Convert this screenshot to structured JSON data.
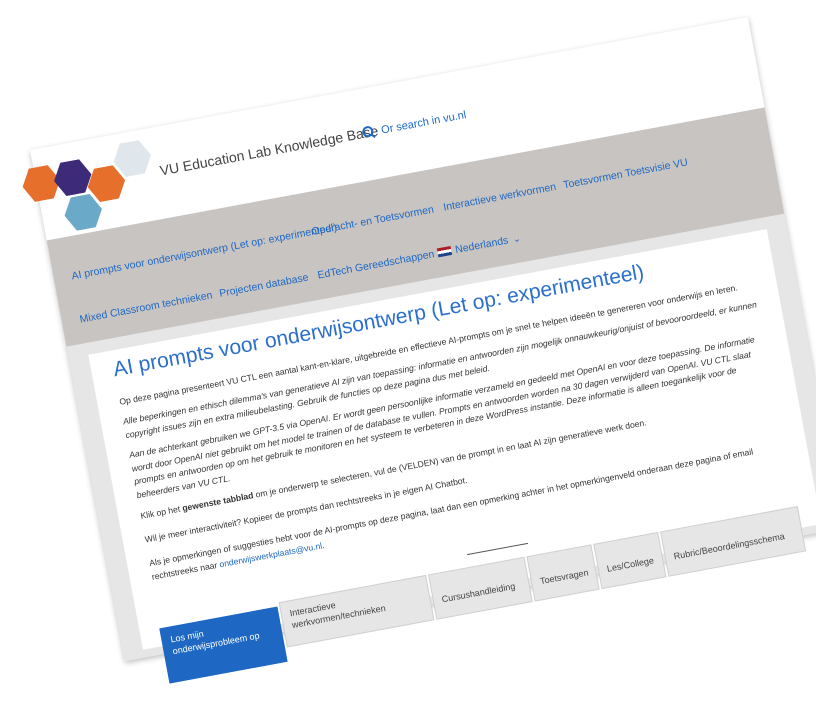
{
  "header": {
    "site_title": "VU Education Lab Knowledge Base",
    "search_link": "Or search in vu.nl"
  },
  "logo": {
    "hex_colors": [
      "#e6702b",
      "#3d2b7a",
      "#6aaac8",
      "#e6702b",
      "#dfe6ec"
    ]
  },
  "nav": {
    "items": [
      "AI prompts voor onderwijsontwerp (Let op: experimenteel)",
      "Opdracht- en Toetsvormen",
      "Interactieve werkvormen",
      "Toetsvormen Toetsvisie VU",
      "Mixed Classroom technieken",
      "Projecten database",
      "EdTech Gereedschappen",
      "Nederlands"
    ]
  },
  "main": {
    "title": "AI prompts voor onderwijsontwerp (Let op: experimenteel)",
    "intro": "Op deze pagina presenteert VU CTL een aantal kant-en-klare, uitgebreide en effectieve AI-prompts om je snel te helpen ideeën te genereren voor onderwijs en leren.",
    "disclaimer1": "Alle beperkingen en ethisch dilemma's van generatieve AI zijn van toepassing: informatie en antwoorden zijn mogelijk onnauwkeurig/onjuist of bevooroordeeld, er kunnen copyright issues zijn en extra milieubelasting. Gebruik de functies op deze pagina dus met beleid.",
    "disclaimer2": "Aan de achterkant gebruiken we GPT-3.5 via OpenAI. Er wordt geen persoonlijke informatie verzameld en gedeeld met OpenAI en voor deze toepassing. De informatie wordt door OpenAI niet gebruikt om het model te trainen of de database te vullen. Prompts en antwoorden worden na 30 dagen verwijderd van OpenAI. VU CTL slaat prompts en antwoorden op om het gebruik te monitoren en het systeem te verbeteren in deze WordPress instantie. Deze informatie is alleen toegankelijk voor de beheerders van VU CTL.",
    "instruction_pre": "Klik op het ",
    "instruction_bold": "gewenste tabblad",
    "instruction_post": " om je onderwerp te selecteren, vul de (VELDEN) van de prompt in en laat AI zijn generatieve werk doen.",
    "interactivity": "Wil je meer interactiviteit? Kopieer de prompts dan rechtstreeks in je eigen AI Chatbot.",
    "feedback_pre": "Als je opmerkingen of suggesties hebt voor de AI-prompts op deze pagina, laat dan een opmerking achter in het opmerkingenveld onderaan deze pagina of email rechtstreeks naar ",
    "feedback_email": "onderwijswerkplaats@vu.nl",
    "feedback_post": "."
  },
  "tabs": [
    {
      "label": "Los mijn onderwijsprobleem op",
      "active": true
    },
    {
      "label": "Interactieve werkvormen/technieken",
      "active": false
    },
    {
      "label": "Cursushandleiding",
      "active": false
    },
    {
      "label": "Toetsvragen",
      "active": false
    },
    {
      "label": "Les/College",
      "active": false
    },
    {
      "label": "Rubric/Beoordelingsschema",
      "active": false
    }
  ]
}
